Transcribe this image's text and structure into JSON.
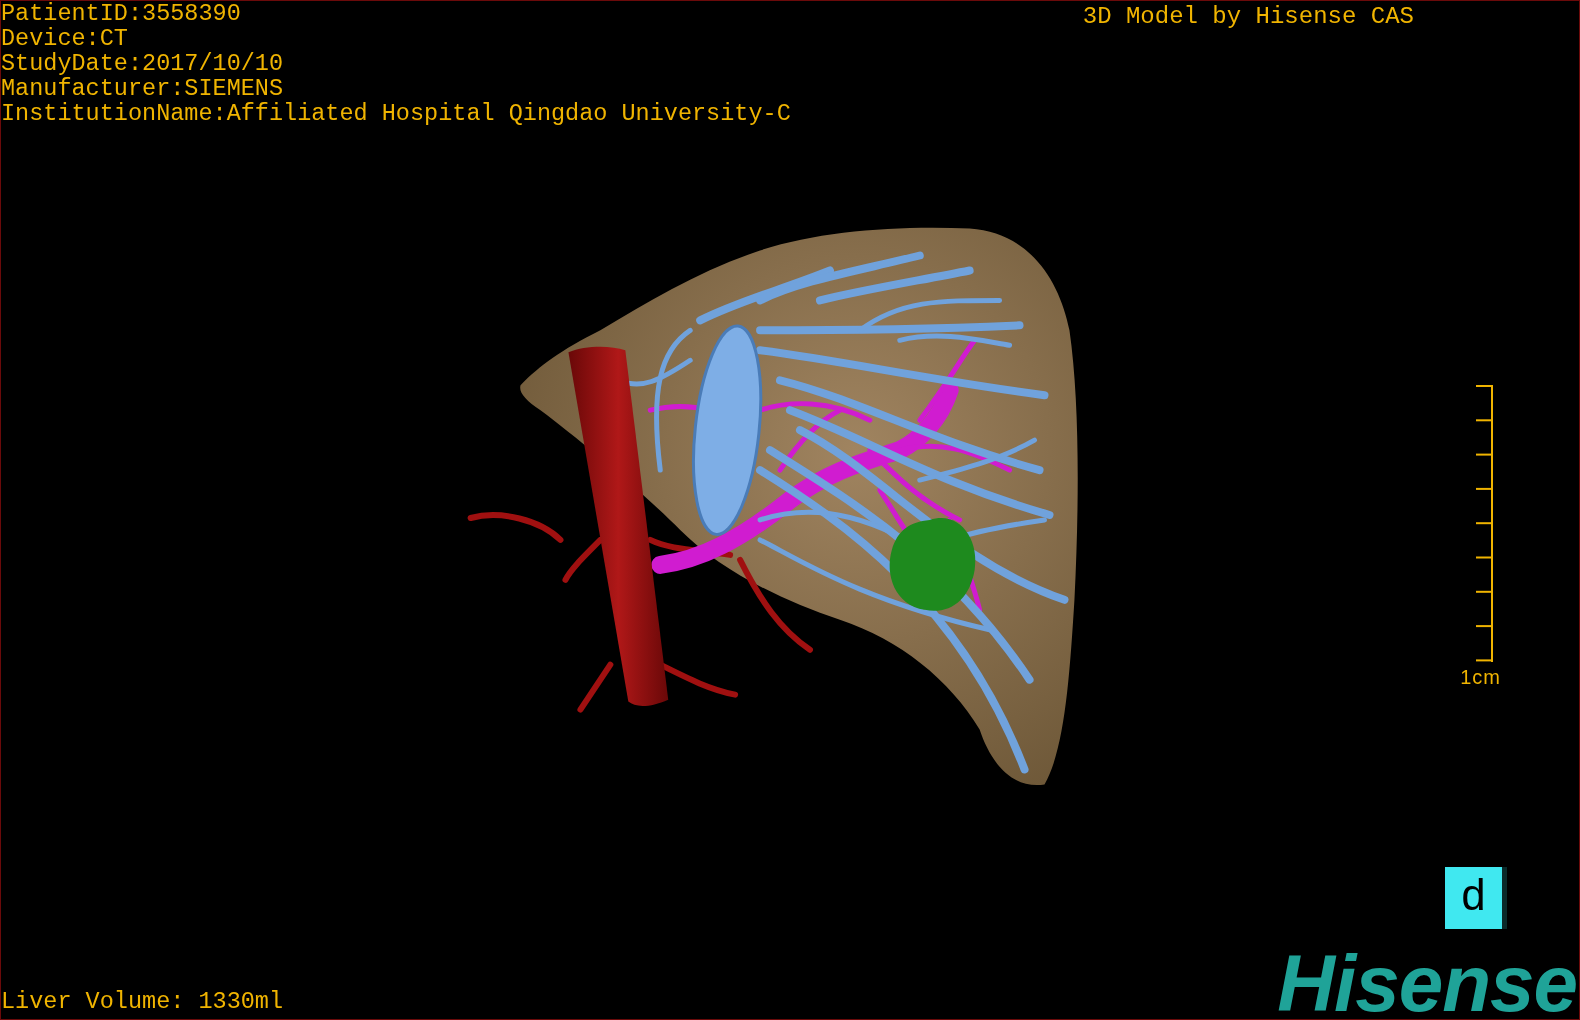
{
  "info_lines": [
    "PatientID:3558390",
    "Device:CT",
    "StudyDate:2017/10/10",
    "Manufacturer:SIEMENS",
    "InstitutionName:Affiliated Hospital Qingdao University-C"
  ],
  "title": "3D Model by Hisense CAS",
  "scale_bar": {
    "label": "1cm"
  },
  "view_button": {
    "label": "d"
  },
  "liver_volume": "Liver Volume: 1330ml",
  "logo": "Hisense"
}
